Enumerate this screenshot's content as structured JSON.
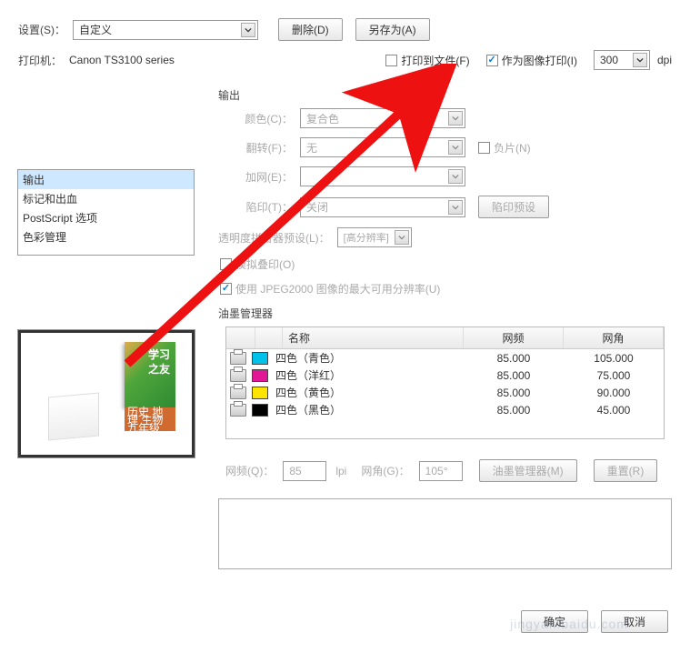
{
  "top": {
    "settings_label": "设置(S)：",
    "settings_value": "自定义",
    "delete_btn": "删除(D)",
    "saveas_btn": "另存为(A)"
  },
  "printer": {
    "label": "打印机：",
    "name": "Canon TS3100 series",
    "print_to_file": "打印到文件(F)",
    "print_as_image": "作为图像打印(I)",
    "dpi_value": "300",
    "dpi_unit": "dpi"
  },
  "side_items": [
    "输出",
    "标记和出血",
    "PostScript 选项",
    "色彩管理"
  ],
  "output": {
    "title": "输出",
    "color_label": "颜色(C)：",
    "color_value": "复合色",
    "flip_label": "翻转(F)：",
    "flip_value": "无",
    "negative": "负片(N)",
    "screen_label": "加网(E)：",
    "trap_label": "陷印(T)：",
    "trap_value": "关闭",
    "trap_preset_btn": "陷印预设",
    "transparency_label": "透明度拼合器预设(L)：",
    "transparency_value": "[高分辨率]",
    "simulate_overprint": "模拟叠印(O)",
    "use_jpeg2000": "使用 JPEG2000 图像的最大可用分辨率(U)"
  },
  "ink": {
    "title": "油墨管理器",
    "headers": {
      "name": "名称",
      "freq": "网频",
      "angle": "网角"
    },
    "rows": [
      {
        "swatch": "#00c2e8",
        "name": "四色（青色）",
        "freq": "85.000",
        "angle": "105.000"
      },
      {
        "swatch": "#e01896",
        "name": "四色（洋红）",
        "freq": "85.000",
        "angle": "75.000"
      },
      {
        "swatch": "#ffe400",
        "name": "四色（黄色）",
        "freq": "85.000",
        "angle": "90.000"
      },
      {
        "swatch": "#000000",
        "name": "四色（黑色）",
        "freq": "85.000",
        "angle": "45.000"
      }
    ],
    "freq_label": "网频(Q)：",
    "freq_value": "85",
    "lpi": "lpi",
    "angle_label": "网角(G)：",
    "angle_value": "105°",
    "ink_mgr_btn": "油墨管理器(M)",
    "reset_btn": "重置(R)"
  },
  "preview": {
    "book_line1": "学习",
    "book_line2": "之友",
    "strip_line1": "历史 地理 生物",
    "strip_line2": "九年级(全一册)"
  },
  "dialog": {
    "ok": "确定",
    "cancel": "取消"
  }
}
